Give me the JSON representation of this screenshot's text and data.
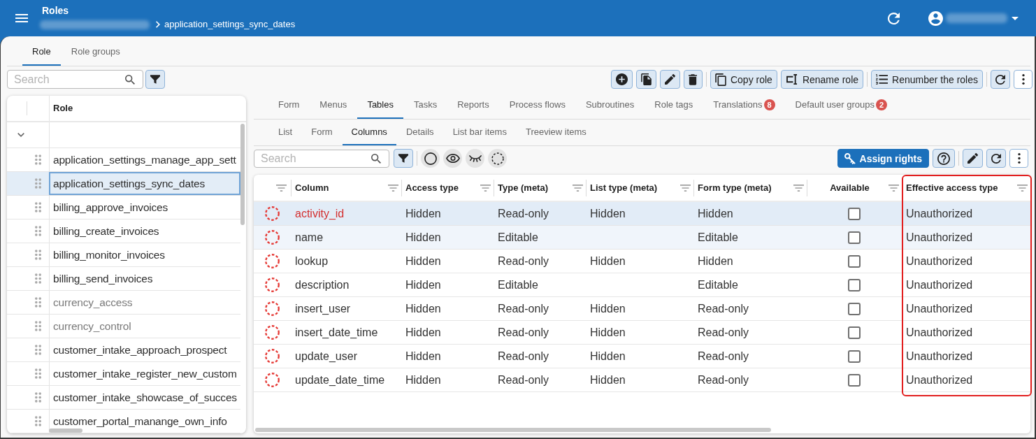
{
  "header": {
    "title": "Roles",
    "breadcrumb": "application_settings_sync_dates"
  },
  "tabs": [
    {
      "label": "Role",
      "selected": true
    },
    {
      "label": "Role groups",
      "selected": false
    }
  ],
  "toolbar": [
    {
      "kind": "add"
    },
    {
      "kind": "duplicate"
    },
    {
      "kind": "edit"
    },
    {
      "kind": "delete"
    },
    {
      "kind": "separator"
    },
    {
      "kind": "copy",
      "label": "Copy role"
    },
    {
      "kind": "rename",
      "label": "Rename role"
    },
    {
      "kind": "separator"
    },
    {
      "kind": "renumber",
      "label": "Renumber the roles"
    },
    {
      "kind": "separator"
    },
    {
      "kind": "refresh"
    },
    {
      "kind": "more"
    }
  ],
  "sidebar": {
    "search": {
      "placeholder": "Search"
    },
    "tools": [
      {
        "kind": "filter"
      }
    ],
    "column": "Role",
    "group_expanded": true,
    "roles": [
      {
        "name": "application_settings_manage_app_sett",
        "selected": false,
        "disabled": false
      },
      {
        "name": "application_settings_sync_dates",
        "selected": true,
        "disabled": false
      },
      {
        "name": "billing_approve_invoices",
        "selected": false,
        "disabled": false
      },
      {
        "name": "billing_create_invoices",
        "selected": false,
        "disabled": false
      },
      {
        "name": "billing_monitor_invoices",
        "selected": false,
        "disabled": false
      },
      {
        "name": "billing_send_invoices",
        "selected": false,
        "disabled": false
      },
      {
        "name": "currency_access",
        "selected": false,
        "disabled": true
      },
      {
        "name": "currency_control",
        "selected": false,
        "disabled": true
      },
      {
        "name": "customer_intake_approach_prospect",
        "selected": false,
        "disabled": false
      },
      {
        "name": "customer_intake_register_new_custom",
        "selected": false,
        "disabled": false
      },
      {
        "name": "customer_intake_showcase_of_succes",
        "selected": false,
        "disabled": false
      },
      {
        "name": "customer_portal_manange_own_info",
        "selected": false,
        "disabled": false
      }
    ]
  },
  "detail_tabs": [
    {
      "label": "Form",
      "selected": false
    },
    {
      "label": "Menus",
      "selected": false
    },
    {
      "label": "Tables",
      "selected": true
    },
    {
      "label": "Tasks",
      "selected": false
    },
    {
      "label": "Reports",
      "selected": false
    },
    {
      "label": "Process flows",
      "selected": false
    },
    {
      "label": "Subroutines",
      "selected": false
    },
    {
      "label": "Role tags",
      "selected": false
    },
    {
      "label": "Translations",
      "badge": "8",
      "selected": false
    },
    {
      "label": "Default user groups",
      "badge": "2",
      "selected": false
    }
  ],
  "sub_tabs": [
    {
      "label": "List",
      "selected": false
    },
    {
      "label": "Form",
      "selected": false
    },
    {
      "label": "Columns",
      "selected": true
    },
    {
      "label": "Details",
      "selected": false
    },
    {
      "label": "List bar items",
      "selected": false
    },
    {
      "label": "Treeview items",
      "selected": false
    }
  ],
  "columns_toolbar": {
    "search": {
      "placeholder": "Search"
    },
    "left": [
      {
        "kind": "filter"
      },
      {
        "kind": "separator"
      },
      {
        "kind": "circle"
      },
      {
        "kind": "eye"
      },
      {
        "kind": "eye-closed"
      },
      {
        "kind": "dashed-circle"
      }
    ],
    "right": [
      {
        "kind": "assign",
        "label": "Assign rights"
      },
      {
        "kind": "help"
      },
      {
        "kind": "separator"
      },
      {
        "kind": "edit"
      },
      {
        "kind": "refresh"
      },
      {
        "kind": "more"
      }
    ]
  },
  "table": {
    "columns": [
      {
        "label": "Column",
        "kind": "text",
        "highlighted": false
      },
      {
        "label": "Access type",
        "kind": "text",
        "highlighted": false
      },
      {
        "label": "Type (meta)",
        "kind": "text",
        "highlighted": false
      },
      {
        "label": "List type (meta)",
        "kind": "text",
        "highlighted": false
      },
      {
        "label": "Form type (meta)",
        "kind": "text",
        "highlighted": false
      },
      {
        "label": "Available",
        "kind": "checkbox",
        "highlighted": false
      },
      {
        "label": "Effective access type",
        "kind": "text",
        "highlighted": true
      }
    ],
    "rows": [
      {
        "cells": [
          "activity_id",
          "Hidden",
          "Read-only",
          "Hidden",
          "Hidden",
          {
            "checked": false
          },
          "Unauthorized"
        ],
        "selected": true,
        "hovered": false,
        "flagged": true
      },
      {
        "cells": [
          "name",
          "Hidden",
          "Editable",
          null,
          "Editable",
          {
            "checked": false
          },
          "Unauthorized"
        ],
        "selected": false,
        "hovered": true,
        "flagged": false
      },
      {
        "cells": [
          "lookup",
          "Hidden",
          "Read-only",
          "Hidden",
          "Hidden",
          {
            "checked": false
          },
          "Unauthorized"
        ],
        "selected": false,
        "hovered": false,
        "flagged": false
      },
      {
        "cells": [
          "description",
          "Hidden",
          "Editable",
          null,
          "Editable",
          {
            "checked": false
          },
          "Unauthorized"
        ],
        "selected": false,
        "hovered": false,
        "flagged": false
      },
      {
        "cells": [
          "insert_user",
          "Hidden",
          "Read-only",
          "Hidden",
          "Read-only",
          {
            "checked": false
          },
          "Unauthorized"
        ],
        "selected": false,
        "hovered": false,
        "flagged": false
      },
      {
        "cells": [
          "insert_date_time",
          "Hidden",
          "Read-only",
          "Hidden",
          "Read-only",
          {
            "checked": false
          },
          "Unauthorized"
        ],
        "selected": false,
        "hovered": false,
        "flagged": false
      },
      {
        "cells": [
          "update_user",
          "Hidden",
          "Read-only",
          "Hidden",
          "Read-only",
          {
            "checked": false
          },
          "Unauthorized"
        ],
        "selected": false,
        "hovered": false,
        "flagged": false
      },
      {
        "cells": [
          "update_date_time",
          "Hidden",
          "Read-only",
          "Hidden",
          "Read-only",
          {
            "checked": false
          },
          "Unauthorized"
        ],
        "selected": false,
        "hovered": false,
        "flagged": false
      }
    ]
  }
}
